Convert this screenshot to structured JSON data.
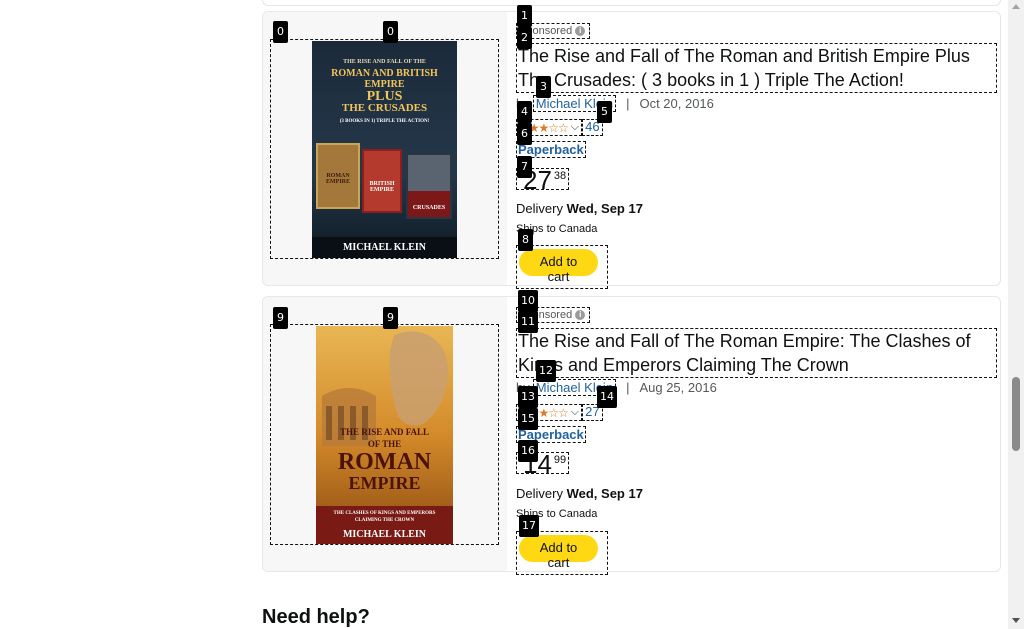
{
  "products": [
    {
      "sponsored_label": "Sponsored",
      "title": "The Rise and Fall of The Roman and British Empire Plus The Crusades: ( 3 books in 1 ) Triple The Action!",
      "by": "by",
      "author": "Michael Klein",
      "separator": "|",
      "date": "Oct 20, 2016",
      "stars": "★★★☆☆",
      "rating_fraction": 0.65,
      "review_count": "46",
      "format": "Paperback",
      "price_symbol": "$",
      "price_whole": "27",
      "price_fraction": "38",
      "delivery_label": "Delivery",
      "delivery_date": "Wed, Sep 17",
      "ships_to": "Ships to Canada",
      "add_to_cart": "Add to cart",
      "cover": {
        "title_lines": [
          "THE RISE AND FALL OF THE",
          "ROMAN AND BRITISH",
          "EMPIRE",
          "PLUS",
          "THE CRUSADES"
        ],
        "subtitle": "(3 BOOKS IN 1) TRIPLE THE ACTION!",
        "author": "MICHAEL KLEIN",
        "mini_books": [
          "ROMAN EMPIRE",
          "BRITISH EMPIRE",
          "CRUSADES"
        ]
      }
    },
    {
      "sponsored_label": "Sponsored",
      "title": "The Rise and Fall of The Roman Empire: The Clashes of Kings and Emperors Claiming The Crown",
      "by": "by",
      "author": "Michael Klein",
      "separator": "|",
      "date": "Aug 25, 2016",
      "stars": "★★★☆☆",
      "rating_fraction": 0.55,
      "review_count": "27",
      "format": "Paperback",
      "price_symbol": "$",
      "price_whole": "14",
      "price_fraction": "99",
      "delivery_label": "Delivery",
      "delivery_date": "Wed, Sep 17",
      "ships_to": "Ships to Canada",
      "add_to_cart": "Add to cart",
      "cover": {
        "title_lines": [
          "THE RISE AND FALL",
          "OF THE",
          "ROMAN",
          "EMPIRE"
        ],
        "subtitle": "THE CLASHES OF KINGS AND EMPERORS CLAIMING THE CROWN",
        "author": "MICHAEL KLEIN"
      }
    }
  ],
  "badges": [
    "0",
    "1",
    "2",
    "3",
    "4",
    "5",
    "6",
    "7",
    "8",
    "9",
    "10",
    "11",
    "12",
    "13",
    "14",
    "15",
    "16",
    "17"
  ],
  "footer": {
    "need_help": "Need help?"
  },
  "colors": {
    "link": "#2162a1",
    "star": "#de7921",
    "cart_button": "#ffd814",
    "card_border": "#e7e7e7"
  }
}
